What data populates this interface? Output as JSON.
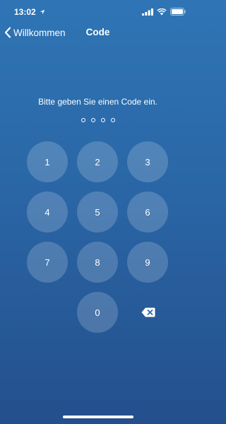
{
  "status": {
    "time": "13:02"
  },
  "nav": {
    "back_label": "Willkommen",
    "title": "Code"
  },
  "prompt": "Bitte geben Sie einen Code ein.",
  "code": {
    "length": 4,
    "entered": 0
  },
  "keypad": [
    "1",
    "2",
    "3",
    "4",
    "5",
    "6",
    "7",
    "8",
    "9",
    "0"
  ]
}
